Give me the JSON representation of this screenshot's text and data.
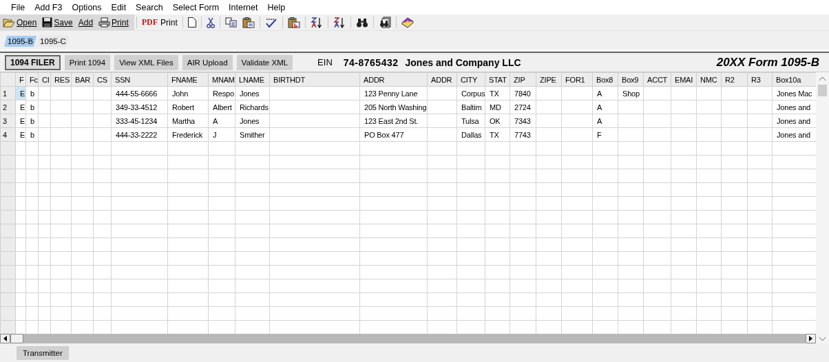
{
  "menu": [
    "File",
    "Add F3",
    "Options",
    "Edit",
    "Search",
    "Select Form",
    "Internet",
    "Help"
  ],
  "toolbar": [
    {
      "kind": "open",
      "label": "Open"
    },
    {
      "kind": "save",
      "label": "Save"
    },
    {
      "kind": "text",
      "label": "Add"
    },
    {
      "kind": "print",
      "label": "Print"
    },
    {
      "kind": "pdf",
      "badge": "PDF",
      "label": "Print"
    },
    {
      "kind": "new"
    },
    {
      "kind": "cut"
    },
    {
      "kind": "copy"
    },
    {
      "kind": "paste"
    },
    {
      "kind": "spell"
    },
    {
      "kind": "paste-special"
    },
    {
      "kind": "sort-up"
    },
    {
      "kind": "sort-down"
    },
    {
      "kind": "find"
    },
    {
      "kind": "find-files"
    },
    {
      "kind": "help"
    }
  ],
  "tabs": [
    {
      "label": "1095-B",
      "selected": true
    },
    {
      "label": "1095-C",
      "selected": false
    }
  ],
  "actions": [
    {
      "label": "1094 FILER",
      "pressed": true
    },
    {
      "label": "Print 1094",
      "pressed": false
    },
    {
      "label": "View XML Files",
      "pressed": false
    },
    {
      "label": "AIR Upload",
      "pressed": false
    },
    {
      "label": "Validate XML",
      "pressed": false
    }
  ],
  "ein": {
    "label": "EIN",
    "value": "74-8765432",
    "company": "Jones and Company LLC"
  },
  "form_title": "20XX Form 1095-B",
  "table": {
    "columns": [
      "F",
      "Fc",
      "CI",
      "RES",
      "BAR",
      "CS",
      "SSN",
      "FNAME",
      "MNAM",
      "LNAME",
      "BIRTHDT",
      "ADDR",
      "ADDR",
      "CITY",
      "STAT",
      "ZIP",
      "ZIPE",
      "FOR1",
      "Box8",
      "Box9",
      "ACCT",
      "EMAI",
      "NMC",
      "R2",
      "R3",
      "Box10a"
    ],
    "rows": [
      {
        "number": "1",
        "current": true,
        "cells": [
          "E",
          "b",
          "",
          "",
          "",
          "",
          "444-55-6666",
          "John",
          "Respo",
          "Jones",
          "",
          "123 Penny Lane",
          "",
          "Corpus",
          "TX",
          "7840",
          "",
          "",
          "A",
          "Shop",
          "",
          "",
          "",
          "",
          "",
          "Jones Mac"
        ]
      },
      {
        "number": "2",
        "current": false,
        "cells": [
          "E",
          "b",
          "",
          "",
          "",
          "",
          "349-33-4512",
          "Robert",
          "Albert",
          "Richards",
          "",
          "205 North Washing",
          "",
          "Baltim",
          "MD",
          "2724",
          "",
          "",
          "A",
          "",
          "",
          "",
          "",
          "",
          "",
          "Jones and"
        ]
      },
      {
        "number": "3",
        "current": false,
        "cells": [
          "E",
          "b",
          "",
          "",
          "",
          "",
          "333-45-1234",
          "Martha",
          "A",
          "Jones",
          "",
          "123 East 2nd St.",
          "",
          "Tulsa",
          "OK",
          "7343",
          "",
          "",
          "A",
          "",
          "",
          "",
          "",
          "",
          "",
          "Jones and"
        ]
      },
      {
        "number": "4",
        "current": false,
        "cells": [
          "E",
          "b",
          "",
          "",
          "",
          "",
          "444-33-2222",
          "Frederick",
          "J",
          "Smither",
          "",
          "PO Box 477",
          "",
          "Dallas",
          "TX",
          "7743",
          "",
          "",
          "F",
          "",
          "",
          "",
          "",
          "",
          "",
          "Jones and"
        ]
      }
    ]
  },
  "bottom_button": "Transmitter"
}
